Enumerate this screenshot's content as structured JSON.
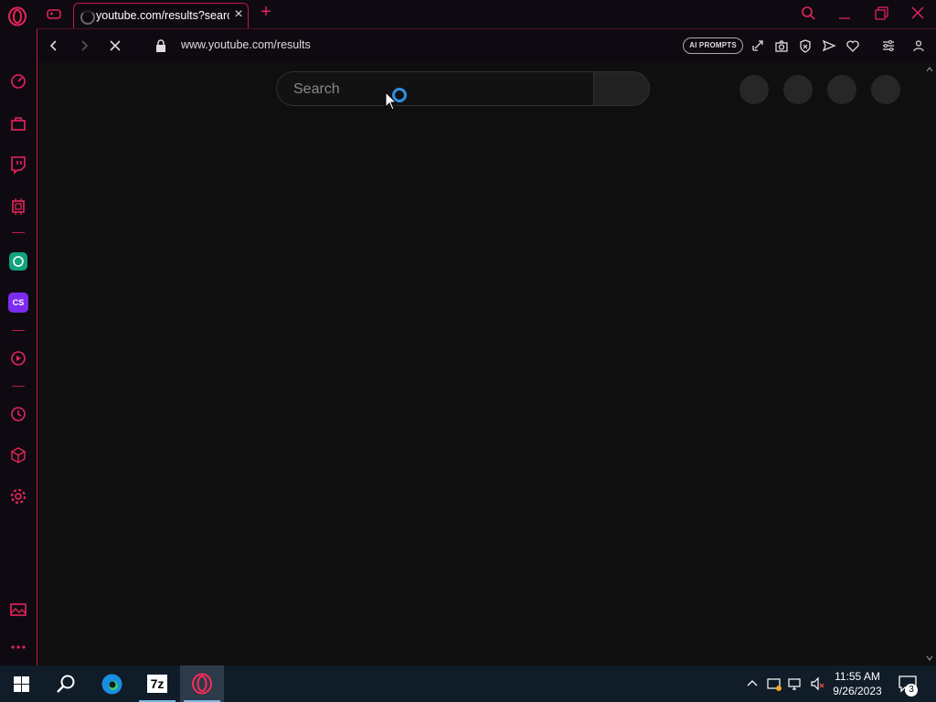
{
  "browser": {
    "tab": {
      "title": "youtube.com/results?search"
    },
    "address": {
      "url": "www.youtube.com/results"
    },
    "toolbar": {
      "ai_prompts_label": "AI PROMPTS"
    },
    "accent_color": "#e8245a"
  },
  "sidebar": {
    "items": [
      "speed-dial-icon",
      "bag-icon",
      "twitch-icon",
      "cpu-icon",
      "chatgpt-icon",
      "cs-icon",
      "player-icon",
      "history-icon",
      "cube-icon",
      "settings-icon",
      "gallery-icon",
      "more-icon"
    ],
    "cs_label": "CS"
  },
  "page": {
    "search": {
      "placeholder": "Search"
    }
  },
  "taskbar": {
    "sevenzip_label": "7z",
    "clock": {
      "time": "11:55 AM",
      "date": "9/26/2023"
    },
    "notification_count": "3"
  }
}
